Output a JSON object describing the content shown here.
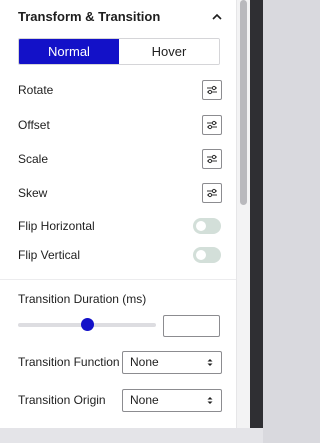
{
  "section": {
    "title": "Transform & Transition",
    "collapse_icon": "chevron-up-icon"
  },
  "tabs": [
    {
      "label": "Normal",
      "active": true
    },
    {
      "label": "Hover",
      "active": false
    }
  ],
  "transform_items": [
    {
      "label": "Rotate",
      "icon": "settings-sliders-icon"
    },
    {
      "label": "Offset",
      "icon": "settings-sliders-icon"
    },
    {
      "label": "Scale",
      "icon": "settings-sliders-icon"
    },
    {
      "label": "Skew",
      "icon": "settings-sliders-icon"
    }
  ],
  "toggles": [
    {
      "label": "Flip Horizontal",
      "on": false
    },
    {
      "label": "Flip Vertical",
      "on": false
    }
  ],
  "transition": {
    "duration_label": "Transition Duration (ms)",
    "duration_slider_fraction": 0.5,
    "duration_value": "",
    "function_label": "Transition Function",
    "function_value": "None",
    "origin_label": "Transition Origin",
    "origin_value": "None"
  },
  "colors": {
    "accent": "#1311c8",
    "toggle_off": "#d3dfd9"
  }
}
